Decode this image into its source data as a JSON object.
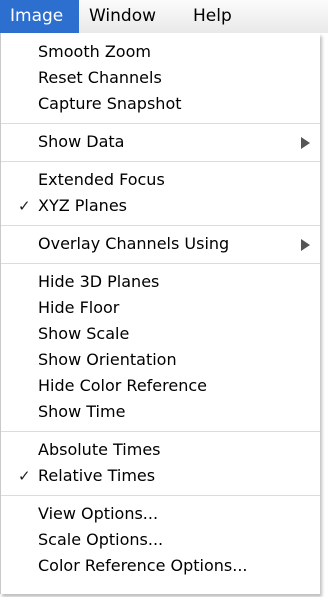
{
  "menubar": {
    "titles": [
      "Image",
      "Window",
      "Help"
    ],
    "active_index": 0
  },
  "menu": {
    "groups": [
      [
        {
          "label": "Smooth Zoom"
        },
        {
          "label": "Reset Channels"
        },
        {
          "label": "Capture Snapshot"
        }
      ],
      [
        {
          "label": "Show Data",
          "submenu": true
        }
      ],
      [
        {
          "label": "Extended Focus"
        },
        {
          "label": "XYZ Planes",
          "checked": true
        }
      ],
      [
        {
          "label": "Overlay Channels Using",
          "submenu": true
        }
      ],
      [
        {
          "label": "Hide 3D Planes"
        },
        {
          "label": "Hide Floor"
        },
        {
          "label": "Show Scale"
        },
        {
          "label": "Show Orientation"
        },
        {
          "label": "Hide Color Reference"
        },
        {
          "label": "Show Time"
        }
      ],
      [
        {
          "label": "Absolute Times"
        },
        {
          "label": "Relative Times",
          "checked": true
        }
      ],
      [
        {
          "label": "View Options..."
        },
        {
          "label": "Scale Options..."
        },
        {
          "label": "Color Reference Options..."
        }
      ]
    ],
    "check_glyph": "✓",
    "colors": {
      "highlight": "#2d6fcf",
      "separator": "#dcdcdc"
    }
  }
}
